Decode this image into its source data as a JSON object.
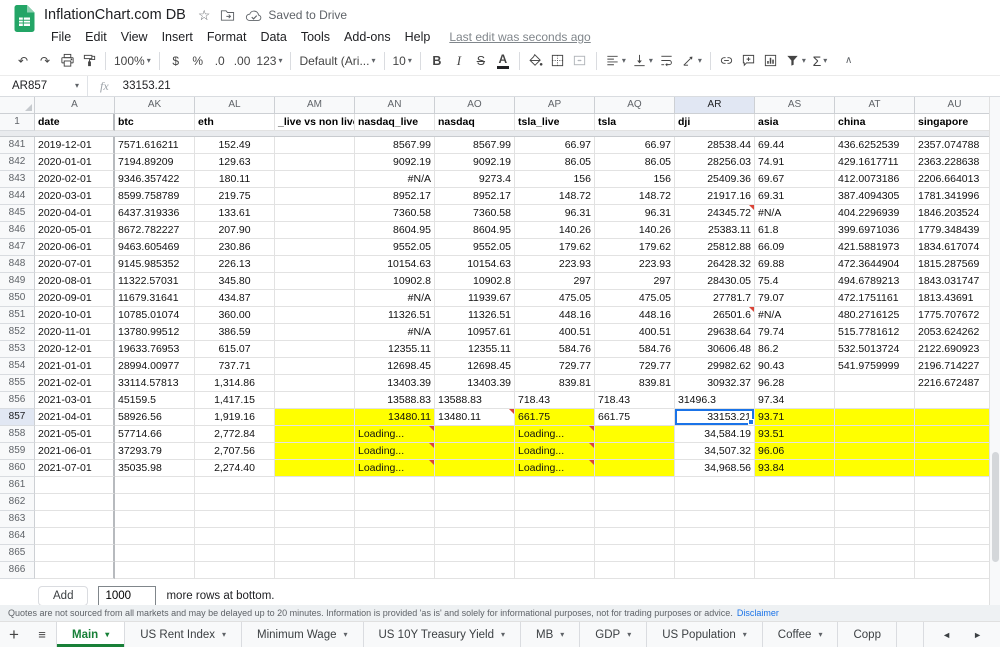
{
  "titlebar": {
    "title": "InflationChart.com DB",
    "saved": "Saved to Drive"
  },
  "menubar": {
    "items": [
      "File",
      "Edit",
      "View",
      "Insert",
      "Format",
      "Data",
      "Tools",
      "Add-ons",
      "Help"
    ],
    "last_edit": "Last edit was seconds ago"
  },
  "icons": {
    "star": "☆",
    "caret": "▾",
    "plus": "+",
    "all_sheets": "≡",
    "undo": "↶",
    "redo": "↷",
    "collapse": "∧",
    "scroll_left": "◄",
    "scroll_right": "►",
    "sigma": "Σ"
  },
  "toolbar": {
    "zoom": "100%",
    "currency": "$",
    "percent": "%",
    "decimal_decrease": ".0",
    "decimal_increase": ".00",
    "more_formats": "123",
    "font": "Default (Ari...",
    "font_size": "10",
    "bold": "B",
    "italic": "I",
    "strikethrough": "S",
    "text_color": "A"
  },
  "formula_bar": {
    "name_box": "AR857",
    "fx": "fx",
    "value": "33153.21"
  },
  "grid": {
    "row1_number": "1",
    "columns": [
      {
        "id": "A",
        "align": "left"
      },
      {
        "id": "AK",
        "align": "left"
      },
      {
        "id": "AL",
        "align": "center"
      },
      {
        "id": "AM",
        "align": "left"
      },
      {
        "id": "AN",
        "align": "right"
      },
      {
        "id": "AO",
        "align": "right"
      },
      {
        "id": "AP",
        "align": "right"
      },
      {
        "id": "AQ",
        "align": "right"
      },
      {
        "id": "AR",
        "align": "right"
      },
      {
        "id": "AS",
        "align": "left"
      },
      {
        "id": "AT",
        "align": "left"
      },
      {
        "id": "AU",
        "align": "left"
      }
    ],
    "field_row": [
      "date",
      "btc",
      "eth",
      "_live vs non live",
      "nasdaq_live",
      "nasdaq",
      "tsla_live",
      "tsla",
      "dji",
      "asia",
      "china",
      "singapore"
    ],
    "selected": {
      "row": "857",
      "col": "AR"
    },
    "rows": [
      {
        "n": "841",
        "cells": [
          "2019-12-01",
          "7571.616211",
          "152.49",
          "",
          "8567.99",
          "8567.99",
          "66.97",
          "66.97",
          "28538.44",
          "69.44",
          "436.6252539",
          "2357.074788"
        ]
      },
      {
        "n": "842",
        "cells": [
          "2020-01-01",
          "7194.89209",
          "129.63",
          "",
          "9092.19",
          "9092.19",
          "86.05",
          "86.05",
          "28256.03",
          "74.91",
          "429.1617711",
          "2363.228638"
        ]
      },
      {
        "n": "843",
        "cells": [
          "2020-02-01",
          "9346.357422",
          "180.11",
          "",
          "#N/A",
          "9273.4",
          "156",
          "156",
          "25409.36",
          "69.67",
          "412.0073186",
          "2206.664013"
        ]
      },
      {
        "n": "844",
        "cells": [
          "2020-03-01",
          "8599.758789",
          "219.75",
          "",
          "8952.17",
          "8952.17",
          "148.72",
          "148.72",
          "21917.16",
          "69.31",
          "387.4094305",
          "1781.341996"
        ]
      },
      {
        "n": "845",
        "cells": [
          "2020-04-01",
          "6437.319336",
          "133.61",
          "",
          "7360.58",
          "7360.58",
          "96.31",
          "96.31",
          "24345.72",
          "#N/A",
          "404.2296939",
          "1846.203524"
        ]
      },
      {
        "n": "846",
        "cells": [
          "2020-05-01",
          "8672.782227",
          "207.90",
          "",
          "8604.95",
          "8604.95",
          "140.26",
          "140.26",
          "25383.11",
          "61.8",
          "399.6971036",
          "1779.348439"
        ]
      },
      {
        "n": "847",
        "cells": [
          "2020-06-01",
          "9463.605469",
          "230.86",
          "",
          "9552.05",
          "9552.05",
          "179.62",
          "179.62",
          "25812.88",
          "66.09",
          "421.5881973",
          "1834.617074"
        ]
      },
      {
        "n": "848",
        "cells": [
          "2020-07-01",
          "9145.985352",
          "226.13",
          "",
          "10154.63",
          "10154.63",
          "223.93",
          "223.93",
          "26428.32",
          "69.88",
          "472.3644904",
          "1815.287569"
        ]
      },
      {
        "n": "849",
        "cells": [
          "2020-08-01",
          "11322.57031",
          "345.80",
          "",
          "10902.8",
          "10902.8",
          "297",
          "297",
          "28430.05",
          "75.4",
          "494.6789213",
          "1843.031747"
        ]
      },
      {
        "n": "850",
        "cells": [
          "2020-09-01",
          "11679.31641",
          "434.87",
          "",
          "#N/A",
          "11939.67",
          "475.05",
          "475.05",
          "27781.7",
          "79.07",
          "472.1751161",
          "1813.43691"
        ]
      },
      {
        "n": "851",
        "cells": [
          "2020-10-01",
          "10785.01074",
          "360.00",
          "",
          "11326.51",
          "11326.51",
          "448.16",
          "448.16",
          "26501.6",
          "#N/A",
          "480.2716125",
          "1775.707672"
        ]
      },
      {
        "n": "852",
        "cells": [
          "2020-11-01",
          "13780.99512",
          "386.59",
          "",
          "#N/A",
          "10957.61",
          "400.51",
          "400.51",
          "29638.64",
          "79.74",
          "515.7781612",
          "2053.624262"
        ]
      },
      {
        "n": "853",
        "cells": [
          "2020-12-01",
          "19633.76953",
          "615.07",
          "",
          "12355.11",
          "12355.11",
          "584.76",
          "584.76",
          "30606.48",
          "86.2",
          "532.5013724",
          "2122.690923"
        ]
      },
      {
        "n": "854",
        "cells": [
          "2021-01-01",
          "28994.00977",
          "737.71",
          "",
          "12698.45",
          "12698.45",
          "729.77",
          "729.77",
          "29982.62",
          "90.43",
          "541.9759999",
          "2196.714227"
        ]
      },
      {
        "n": "855",
        "cells": [
          "2021-02-01",
          "33114.57813",
          "1,314.86",
          "",
          "13403.39",
          "13403.39",
          "839.81",
          "839.81",
          "30932.37",
          "96.28",
          "",
          "2216.672487"
        ]
      },
      {
        "n": "856",
        "cells": [
          "2021-03-01",
          "45159.5",
          "1,417.15",
          "",
          "13588.83",
          "13588.83",
          "718.43",
          "718.43",
          "31496.3",
          "97.34",
          "",
          ""
        ]
      },
      {
        "n": "857",
        "cells": [
          "2021-04-01",
          "58926.56",
          "1,919.16",
          "",
          "13480.11",
          "13480.11",
          "661.75",
          "661.75",
          "33153.21",
          "93.71",
          "",
          ""
        ]
      },
      {
        "n": "858",
        "cells": [
          "2021-05-01",
          "57714.66",
          "2,772.84",
          "",
          "Loading...",
          "",
          "Loading...",
          "",
          "34,584.19",
          "93.51",
          "",
          ""
        ]
      },
      {
        "n": "859",
        "cells": [
          "2021-06-01",
          "37293.79",
          "2,707.56",
          "",
          "Loading...",
          "",
          "Loading...",
          "",
          "34,507.32",
          "96.06",
          "",
          ""
        ]
      },
      {
        "n": "860",
        "cells": [
          "2021-07-01",
          "35035.98",
          "2,274.40",
          "",
          "Loading...",
          "",
          "Loading...",
          "",
          "34,968.56",
          "93.84",
          "",
          ""
        ]
      },
      {
        "n": "861",
        "cells": []
      },
      {
        "n": "862",
        "cells": []
      },
      {
        "n": "863",
        "cells": []
      },
      {
        "n": "864",
        "cells": []
      },
      {
        "n": "865",
        "cells": []
      },
      {
        "n": "866",
        "cells": []
      }
    ],
    "yellow": {
      "857": [
        "AM",
        "AN",
        "AP",
        "AS",
        "AT",
        "AU"
      ],
      "858": [
        "AM",
        "AN",
        "AO",
        "AP",
        "AQ",
        "AS",
        "AT",
        "AU"
      ],
      "859": [
        "AM",
        "AN",
        "AO",
        "AP",
        "AQ",
        "AS",
        "AT",
        "AU"
      ],
      "860": [
        "AM",
        "AN",
        "AO",
        "AP",
        "AQ",
        "AS",
        "AT",
        "AU"
      ]
    },
    "markers": [
      [
        "845",
        "AR"
      ],
      [
        "851",
        "AR"
      ],
      [
        "857",
        "AO"
      ],
      [
        "858",
        "AN"
      ],
      [
        "858",
        "AP"
      ],
      [
        "859",
        "AN"
      ],
      [
        "859",
        "AP"
      ],
      [
        "860",
        "AN"
      ],
      [
        "860",
        "AP"
      ]
    ],
    "align_overrides": [
      [
        "856",
        "AO",
        "left"
      ],
      [
        "856",
        "AP",
        "left"
      ],
      [
        "856",
        "AQ",
        "left"
      ],
      [
        "856",
        "AR",
        "left"
      ],
      [
        "857",
        "AO",
        "left"
      ],
      [
        "857",
        "AP",
        "left"
      ],
      [
        "857",
        "AQ",
        "left"
      ],
      [
        "858",
        "AN",
        "left"
      ],
      [
        "858",
        "AP",
        "left"
      ],
      [
        "859",
        "AN",
        "left"
      ],
      [
        "859",
        "AP",
        "left"
      ],
      [
        "860",
        "AN",
        "left"
      ],
      [
        "860",
        "AP",
        "left"
      ]
    ]
  },
  "add_row": {
    "add_label": "Add",
    "count": "1000",
    "suffix": "more rows at bottom."
  },
  "disclaimer": {
    "text": "Quotes are not sourced from all markets and may be delayed up to 20 minutes. Information is provided 'as is' and solely for informational purposes, not for trading purposes or advice.",
    "link": "Disclaimer"
  },
  "tabs": {
    "items": [
      {
        "label": "Main",
        "active": true
      },
      {
        "label": "US Rent Index"
      },
      {
        "label": "Minimum Wage"
      },
      {
        "label": "US 10Y Treasury Yield"
      },
      {
        "label": "MB"
      },
      {
        "label": "GDP"
      },
      {
        "label": "US Population"
      },
      {
        "label": "Coffee"
      },
      {
        "label": "Copp",
        "truncated": true
      }
    ]
  },
  "colors": {
    "accent": "#1a73e8",
    "highlight": "#ffff00",
    "active_tab": "#188038",
    "marker": "#db4437"
  }
}
